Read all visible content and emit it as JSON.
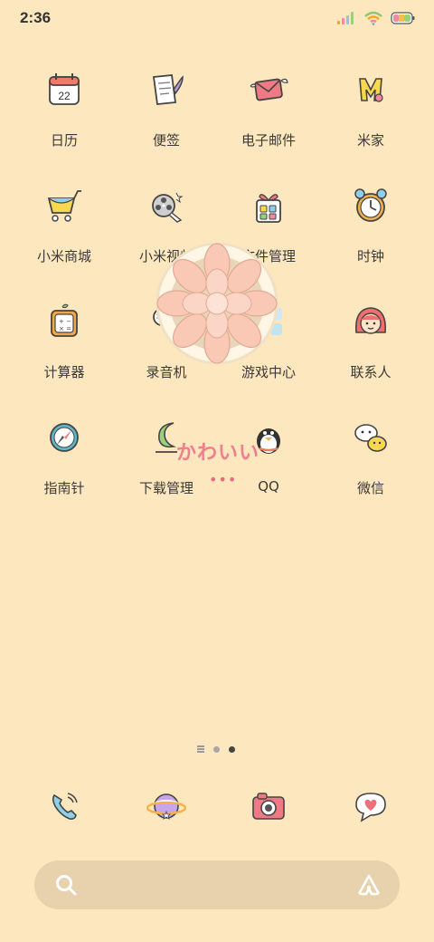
{
  "status_bar": {
    "time": "2:36"
  },
  "apps": [
    {
      "id": "calendar",
      "label": "日历",
      "icon": "calendar-icon",
      "day": "22"
    },
    {
      "id": "notes",
      "label": "便签",
      "icon": "notes-icon"
    },
    {
      "id": "email",
      "label": "电子邮件",
      "icon": "email-icon"
    },
    {
      "id": "mijia",
      "label": "米家",
      "icon": "mijia-icon"
    },
    {
      "id": "mi-store",
      "label": "小米商城",
      "icon": "shopping-cart-icon"
    },
    {
      "id": "mi-video",
      "label": "小米视频",
      "icon": "film-reel-icon"
    },
    {
      "id": "file-manager",
      "label": "文件管理",
      "icon": "gift-box-icon"
    },
    {
      "id": "clock",
      "label": "时钟",
      "icon": "alarm-clock-icon"
    },
    {
      "id": "calculator",
      "label": "计算器",
      "icon": "calculator-icon"
    },
    {
      "id": "recorder",
      "label": "录音机",
      "icon": "microphone-icon"
    },
    {
      "id": "game-center",
      "label": "游戏中心",
      "icon": "game-grid-icon"
    },
    {
      "id": "contacts",
      "label": "联系人",
      "icon": "girl-face-icon"
    },
    {
      "id": "compass",
      "label": "指南针",
      "icon": "compass-icon"
    },
    {
      "id": "downloads",
      "label": "下载管理",
      "icon": "download-moon-icon"
    },
    {
      "id": "qq",
      "label": "QQ",
      "icon": "penguin-icon"
    },
    {
      "id": "wechat",
      "label": "微信",
      "icon": "wechat-icon"
    }
  ],
  "widget": {
    "text": "かわいい",
    "dots": "•••",
    "icon": "succulent-icon"
  },
  "dock": [
    {
      "id": "phone",
      "icon": "phone-icon"
    },
    {
      "id": "browser",
      "icon": "planet-icon"
    },
    {
      "id": "camera",
      "icon": "camera-icon"
    },
    {
      "id": "messages",
      "icon": "heart-bubble-icon"
    }
  ],
  "page_indicator": {
    "pages": 2,
    "current": 2
  },
  "search": {
    "icon": "search-icon",
    "assistant_icon": "assistant-icon"
  },
  "colors": {
    "background": "#fde7be",
    "search_bar": "#e8d2ae",
    "accent_pink": "#ef7f8e"
  }
}
